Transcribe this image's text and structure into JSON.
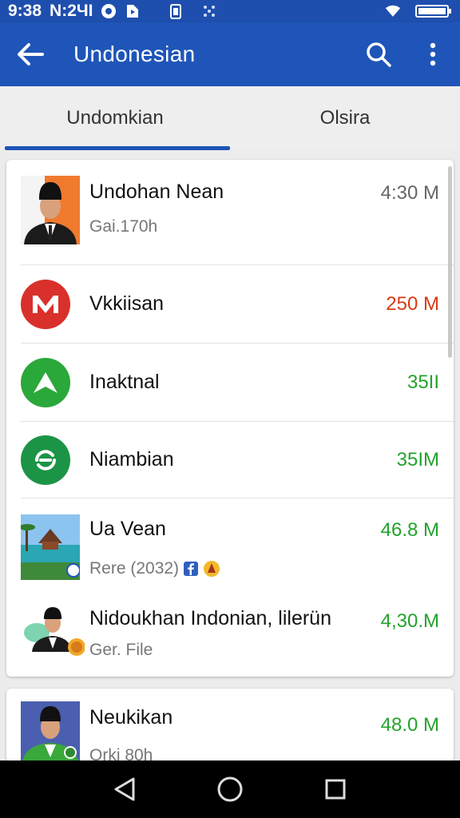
{
  "status_bar": {
    "time": "9:38",
    "carrier": "N:2ЧI"
  },
  "app_bar": {
    "title": "Undonesian",
    "back_icon": "arrow-left-icon",
    "search_icon": "search-icon",
    "menu_icon": "more-vert-icon"
  },
  "tabs": [
    {
      "label": "Undomkian",
      "active": true
    },
    {
      "label": "Olsira",
      "active": false
    }
  ],
  "list": [
    {
      "title": "Undohan Nean",
      "subtitle": "Gai.170h",
      "size": "4:30 M",
      "size_color": "#666666",
      "icon": "person-photo"
    },
    {
      "title": "Vkkiisan",
      "subtitle": "",
      "size": "250 M",
      "size_color": "#d83a14",
      "icon": "red-m-logo"
    },
    {
      "title": "Inaktnal",
      "subtitle": "",
      "size": "35II",
      "size_color": "#23a32c",
      "icon": "green-arrow-logo"
    },
    {
      "title": "Niambian",
      "subtitle": "",
      "size": "35IM",
      "size_color": "#23a32c",
      "icon": "green-refresh-logo"
    },
    {
      "title": "Ua Vean",
      "subtitle": "Rere (2032)",
      "size": "46.8 M",
      "size_color": "#23a32c",
      "icon": "beach-photo"
    },
    {
      "title": "Nidoukhan Indonian, lilerün",
      "subtitle": "Ger. File",
      "size": "4,30.M",
      "size_color": "#23a32c",
      "icon": "person-photo"
    },
    {
      "title": "Neukikan",
      "subtitle": "Orki 80h",
      "size": "48.0 M",
      "size_color": "#23a32c",
      "icon": "person-photo"
    }
  ],
  "nav": {
    "back_icon": "triangle-back-icon",
    "home_icon": "circle-home-icon",
    "recents_icon": "square-recents-icon"
  }
}
